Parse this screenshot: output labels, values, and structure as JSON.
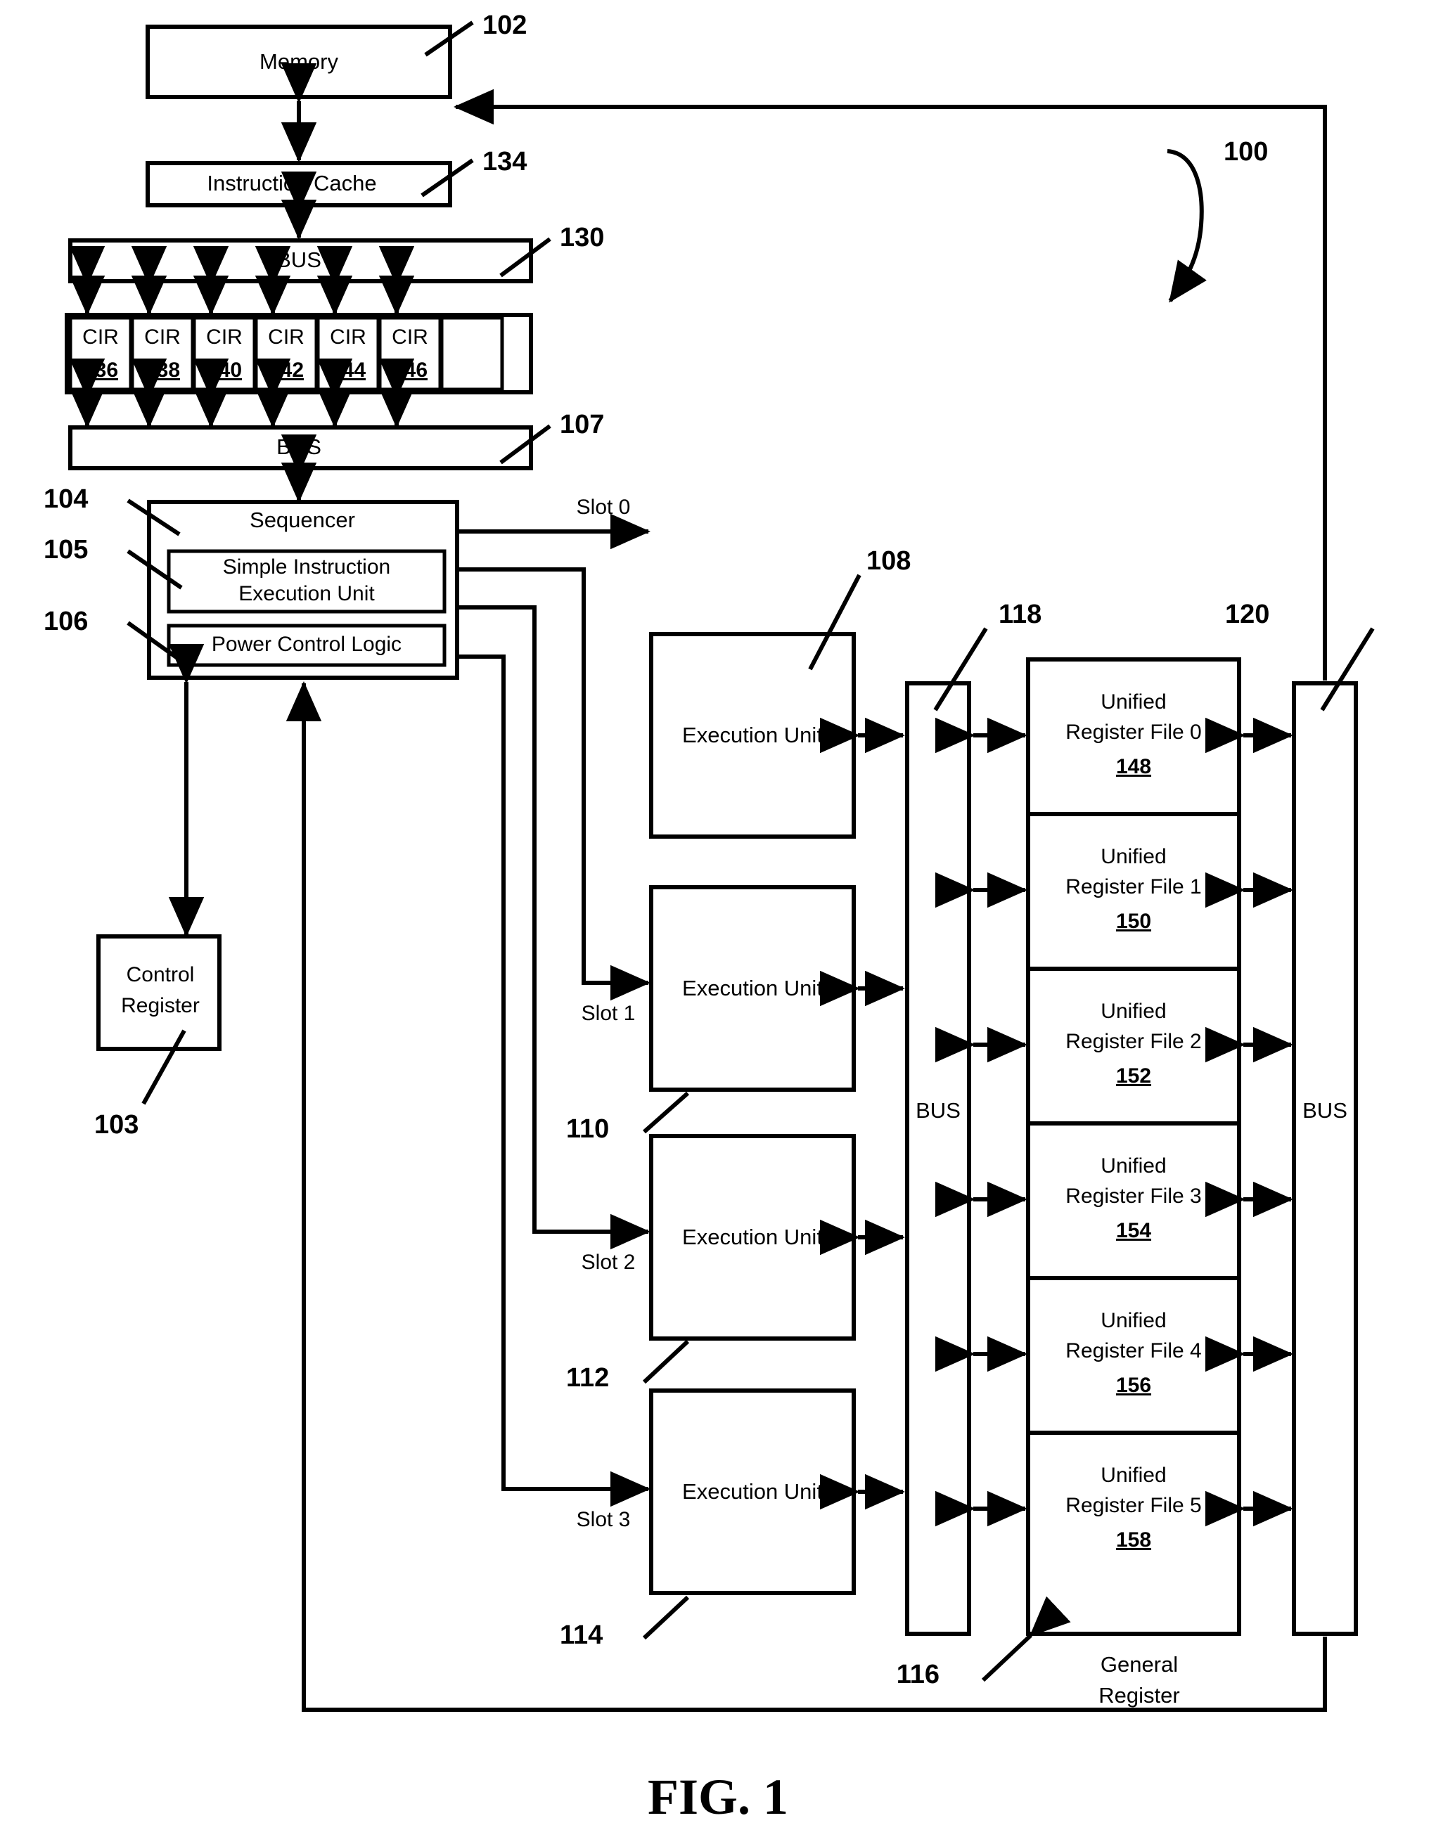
{
  "figure": {
    "caption": "FIG. 1",
    "system_ref": "100"
  },
  "blocks": {
    "memory": {
      "label": "Memory",
      "ref": "102"
    },
    "instruction_cache": {
      "label": "Instruction Cache",
      "ref": "134"
    },
    "bus_top": {
      "label": "BUS",
      "ref": "130"
    },
    "bus_mid": {
      "label": "BUS",
      "ref": "107"
    },
    "sequencer": {
      "label": "Sequencer",
      "ref": "104"
    },
    "simple_instruction_execution_unit": {
      "label_line1": "Simple Instruction",
      "label_line2": "Execution Unit",
      "ref": "105"
    },
    "power_control_logic": {
      "label": "Power Control Logic",
      "ref": "106"
    },
    "control_register": {
      "label_line1": "Control",
      "label_line2": "Register",
      "ref": "103"
    },
    "bus_left_vertical": {
      "label": "BUS",
      "ref": "118"
    },
    "bus_right_vertical": {
      "label": "BUS",
      "ref": "120"
    },
    "general_register": {
      "label_line1": "General",
      "label_line2": "Register",
      "ref": "116"
    }
  },
  "cir_registers": [
    {
      "label": "CIR",
      "ref": "136"
    },
    {
      "label": "CIR",
      "ref": "138"
    },
    {
      "label": "CIR",
      "ref": "140"
    },
    {
      "label": "CIR",
      "ref": "142"
    },
    {
      "label": "CIR",
      "ref": "144"
    },
    {
      "label": "CIR",
      "ref": "146"
    }
  ],
  "execution_units": [
    {
      "label": "Execution Unit",
      "slot": "Slot 0",
      "ref": "108"
    },
    {
      "label": "Execution Unit",
      "slot": "Slot 1",
      "ref": "110"
    },
    {
      "label": "Execution Unit",
      "slot": "Slot 2",
      "ref": "112"
    },
    {
      "label": "Execution Unit",
      "slot": "Slot 3",
      "ref": "114"
    }
  ],
  "register_files": [
    {
      "label_line1": "Unified",
      "label_line2": "Register File 0",
      "ref": "148"
    },
    {
      "label_line1": "Unified",
      "label_line2": "Register File 1",
      "ref": "150"
    },
    {
      "label_line1": "Unified",
      "label_line2": "Register File 2",
      "ref": "152"
    },
    {
      "label_line1": "Unified",
      "label_line2": "Register File 3",
      "ref": "154"
    },
    {
      "label_line1": "Unified",
      "label_line2": "Register File 4",
      "ref": "156"
    },
    {
      "label_line1": "Unified",
      "label_line2": "Register File 5",
      "ref": "158"
    }
  ],
  "colors": {
    "ink": "#000000",
    "paper": "#ffffff"
  }
}
